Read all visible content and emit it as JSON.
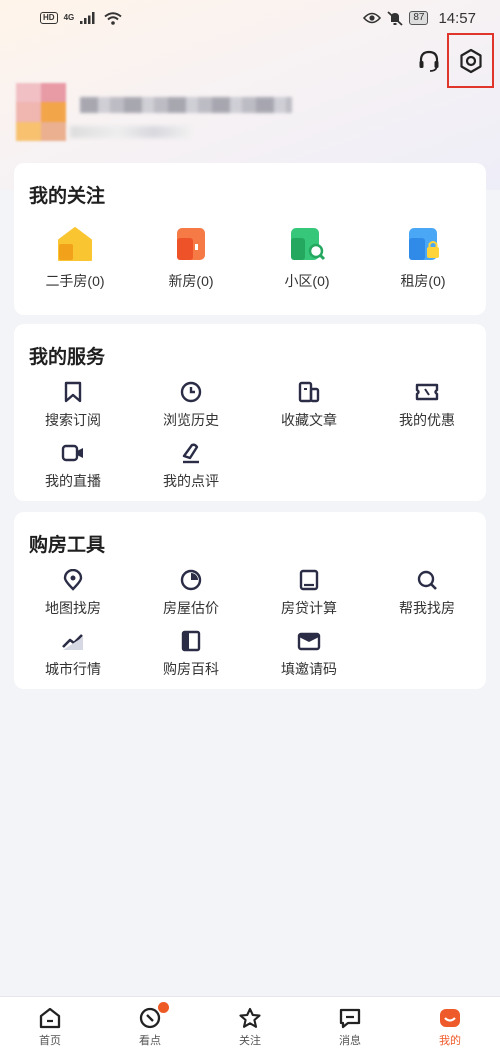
{
  "status_bar": {
    "hd": "HD",
    "network": "4G",
    "battery": "87",
    "time": "14:57"
  },
  "header": {
    "headset_icon": "headset-icon",
    "settings_icon": "settings-icon"
  },
  "follow": {
    "title": "我的关注",
    "items": [
      {
        "label": "二手房(0)",
        "icon": "second-hand-house-icon",
        "color": "#f7b52c"
      },
      {
        "label": "新房(0)",
        "icon": "new-house-icon",
        "color": "#f06a3a"
      },
      {
        "label": "小区(0)",
        "icon": "community-icon",
        "color": "#2fbf6f"
      },
      {
        "label": "租房(0)",
        "icon": "rental-icon",
        "color": "#3a97f0"
      }
    ]
  },
  "services": {
    "title": "我的服务",
    "items": [
      {
        "label": "搜索订阅",
        "icon": "bookmark-icon"
      },
      {
        "label": "浏览历史",
        "icon": "clock-icon"
      },
      {
        "label": "收藏文章",
        "icon": "article-icon"
      },
      {
        "label": "我的优惠",
        "icon": "coupon-icon"
      },
      {
        "label": "我的直播",
        "icon": "video-icon"
      },
      {
        "label": "我的点评",
        "icon": "pen-icon"
      }
    ]
  },
  "tools": {
    "title": "购房工具",
    "items": [
      {
        "label": "地图找房",
        "icon": "map-pin-icon"
      },
      {
        "label": "房屋估价",
        "icon": "pie-icon"
      },
      {
        "label": "房贷计算",
        "icon": "calculator-icon"
      },
      {
        "label": "帮我找房",
        "icon": "search-icon"
      },
      {
        "label": "城市行情",
        "icon": "trend-icon"
      },
      {
        "label": "购房百科",
        "icon": "book-icon"
      },
      {
        "label": "填邀请码",
        "icon": "envelope-icon"
      }
    ]
  },
  "bottom_nav": {
    "items": [
      {
        "label": "首页",
        "icon": "home-icon"
      },
      {
        "label": "看点",
        "icon": "discover-icon"
      },
      {
        "label": "关注",
        "icon": "star-icon"
      },
      {
        "label": "消息",
        "icon": "message-icon"
      },
      {
        "label": "我的",
        "icon": "profile-icon",
        "active": true
      }
    ],
    "accent": "#ef5a2a"
  }
}
